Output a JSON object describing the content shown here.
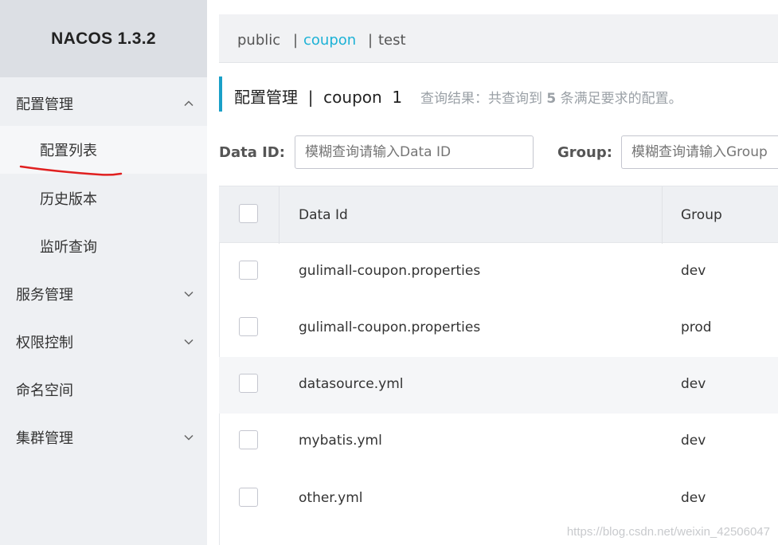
{
  "brand": "NACOS 1.3.2",
  "sidebar": {
    "items": [
      {
        "label": "配置管理",
        "expanded": true
      },
      {
        "label": "配置列表"
      },
      {
        "label": "历史版本"
      },
      {
        "label": "监听查询"
      },
      {
        "label": "服务管理",
        "expanded": false
      },
      {
        "label": "权限控制",
        "expanded": false
      },
      {
        "label": "命名空间"
      },
      {
        "label": "集群管理",
        "expanded": false
      }
    ]
  },
  "namespaces": {
    "items": [
      "public",
      "coupon",
      "test"
    ],
    "separator": "|",
    "active": "coupon"
  },
  "title": {
    "text": "配置管理  |  coupon  1",
    "result_prefix": "查询结果：共查询到 ",
    "result_count": "5",
    "result_suffix": " 条满足要求的配置。"
  },
  "filters": {
    "data_id_label": "Data ID:",
    "data_id_placeholder": "模糊查询请输入Data ID",
    "group_label": "Group:",
    "group_placeholder": "模糊查询请输入Group"
  },
  "table": {
    "headers": [
      "Data Id",
      "Group"
    ],
    "rows": [
      {
        "data_id": "gulimall-coupon.properties",
        "group": "dev"
      },
      {
        "data_id": "gulimall-coupon.properties",
        "group": "prod"
      },
      {
        "data_id": "datasource.yml",
        "group": "dev"
      },
      {
        "data_id": "mybatis.yml",
        "group": "dev"
      },
      {
        "data_id": "other.yml",
        "group": "dev"
      }
    ]
  },
  "watermark": "https://blog.csdn.net/weixin_42506047",
  "colors": {
    "accent": "#1db2d6",
    "annotation": "#e02020"
  }
}
